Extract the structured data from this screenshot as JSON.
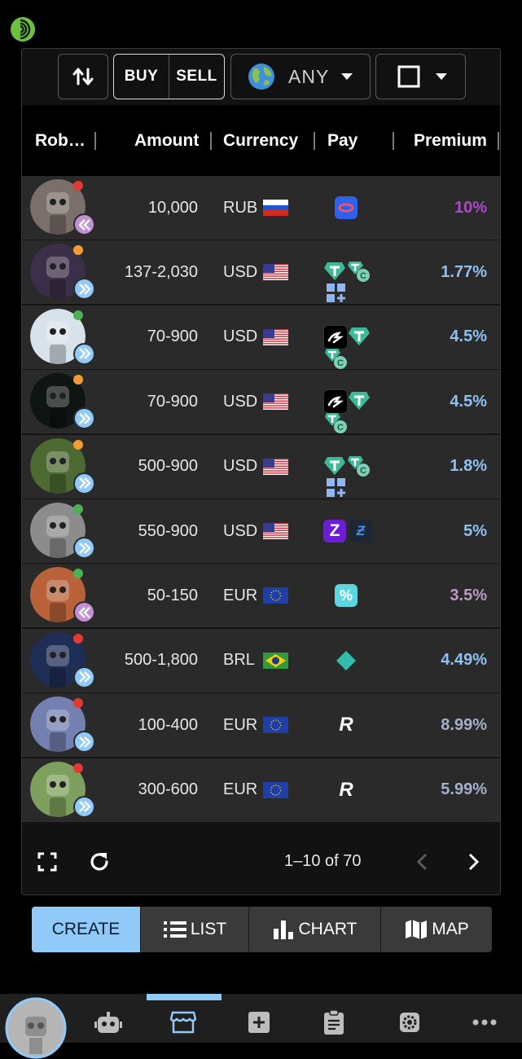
{
  "toolbar": {
    "buy_label": "BUY",
    "sell_label": "SELL",
    "currency_label": "ANY"
  },
  "table": {
    "columns": [
      "Rob…",
      "Amount",
      "Currency",
      "Pay",
      "Premium"
    ],
    "rows": [
      {
        "amount": "10,000",
        "currency": "RUB",
        "flag": "ru",
        "premium": "10%",
        "premium_color": "#a94bc0",
        "status": "#e53935",
        "badge": "sell",
        "avatar_color": "#7a6f6a",
        "pay": [
          "ozon"
        ]
      },
      {
        "amount": "137-2,030",
        "currency": "USD",
        "flag": "us",
        "premium": "1.77%",
        "premium_color": "#90c0f0",
        "status": "#f39c33",
        "badge": "buy",
        "avatar_color": "#3b2f4a",
        "pay": [
          "usdt",
          "usdc",
          "more"
        ]
      },
      {
        "amount": "70-900",
        "currency": "USD",
        "flag": "us",
        "premium": "4.5%",
        "premium_color": "#90c0f0",
        "status": "#4caf50",
        "badge": "buy",
        "avatar_color": "#d8e2ea",
        "pay": [
          "wise",
          "usdt",
          "usdc"
        ]
      },
      {
        "amount": "70-900",
        "currency": "USD",
        "flag": "us",
        "premium": "4.5%",
        "premium_color": "#90c0f0",
        "status": "#f39c33",
        "badge": "buy",
        "avatar_color": "#0e1512",
        "pay": [
          "wise",
          "usdt",
          "usdc"
        ]
      },
      {
        "amount": "500-900",
        "currency": "USD",
        "flag": "us",
        "premium": "1.8%",
        "premium_color": "#90c0f0",
        "status": "#f39c33",
        "badge": "buy",
        "avatar_color": "#4d6a33",
        "pay": [
          "usdt",
          "usdc",
          "more"
        ]
      },
      {
        "amount": "550-900",
        "currency": "USD",
        "flag": "us",
        "premium": "5%",
        "premium_color": "#90c0f0",
        "status": "#4caf50",
        "badge": "buy",
        "avatar_color": "#8c8c8c",
        "pay": [
          "zelle",
          "strike"
        ]
      },
      {
        "amount": "50-150",
        "currency": "EUR",
        "flag": "eu",
        "premium": "3.5%",
        "premium_color": "#b99ac0",
        "status": "#4caf50",
        "badge": "sell",
        "avatar_color": "#b9623a",
        "pay": [
          "cpay"
        ]
      },
      {
        "amount": "500-1,800",
        "currency": "BRL",
        "flag": "br",
        "premium": "4.49%",
        "premium_color": "#90c0f0",
        "status": "#e53935",
        "badge": "buy",
        "avatar_color": "#1e2e55",
        "pay": [
          "pix"
        ]
      },
      {
        "amount": "100-400",
        "currency": "EUR",
        "flag": "eu",
        "premium": "8.99%",
        "premium_color": "#a4b0c8",
        "status": "#e53935",
        "badge": "buy",
        "avatar_color": "#7480b0",
        "pay": [
          "revolut"
        ]
      },
      {
        "amount": "300-600",
        "currency": "EUR",
        "flag": "eu",
        "premium": "5.99%",
        "premium_color": "#a4b0c8",
        "status": "#e53935",
        "badge": "buy",
        "avatar_color": "#7ea05e",
        "pay": [
          "revolut"
        ]
      }
    ]
  },
  "pagination": {
    "range": "1–10 of 70"
  },
  "bottom_tabs": {
    "create": "CREATE",
    "list": "LIST",
    "chart": "CHART",
    "map": "MAP"
  },
  "colors": {
    "accent": "#90caf9",
    "panel": "#121212",
    "row": "#2a2a2a"
  }
}
